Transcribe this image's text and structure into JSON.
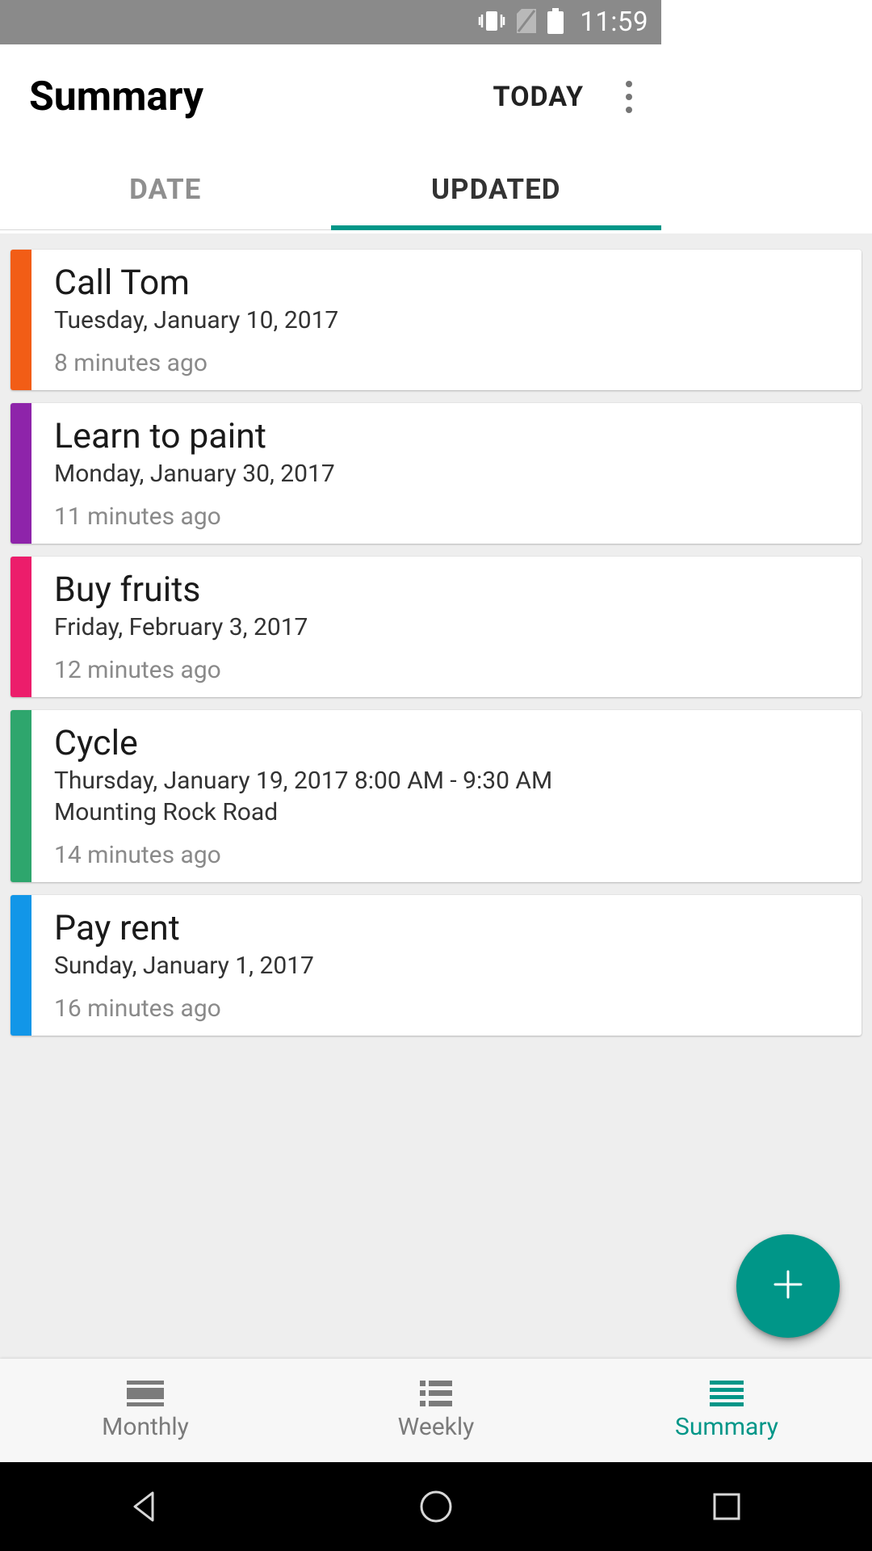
{
  "status": {
    "time": "11:59"
  },
  "header": {
    "title": "Summary",
    "today": "TODAY"
  },
  "tabs": {
    "date": "DATE",
    "updated": "UPDATED",
    "active": "updated"
  },
  "colors": {
    "accent": "#009688",
    "stripes": [
      "#f25d16",
      "#8e24aa",
      "#ec1d6b",
      "#2ea66d",
      "#1296e8"
    ]
  },
  "items": [
    {
      "title": "Call Tom",
      "date": "Tuesday, January 10, 2017",
      "updated": "8 minutes ago"
    },
    {
      "title": "Learn to paint",
      "date": "Monday, January 30, 2017",
      "updated": "11 minutes ago"
    },
    {
      "title": "Buy fruits",
      "date": "Friday, February 3, 2017",
      "updated": "12 minutes ago"
    },
    {
      "title": "Cycle",
      "date": "Thursday, January 19, 2017 8:00 AM - 9:30 AM",
      "location": "Mounting Rock Road",
      "updated": "14 minutes ago"
    },
    {
      "title": "Pay rent",
      "date": "Sunday, January 1, 2017",
      "updated": "16 minutes ago"
    }
  ],
  "bottomNav": {
    "monthly": "Monthly",
    "weekly": "Weekly",
    "summary": "Summary",
    "active": "summary"
  }
}
